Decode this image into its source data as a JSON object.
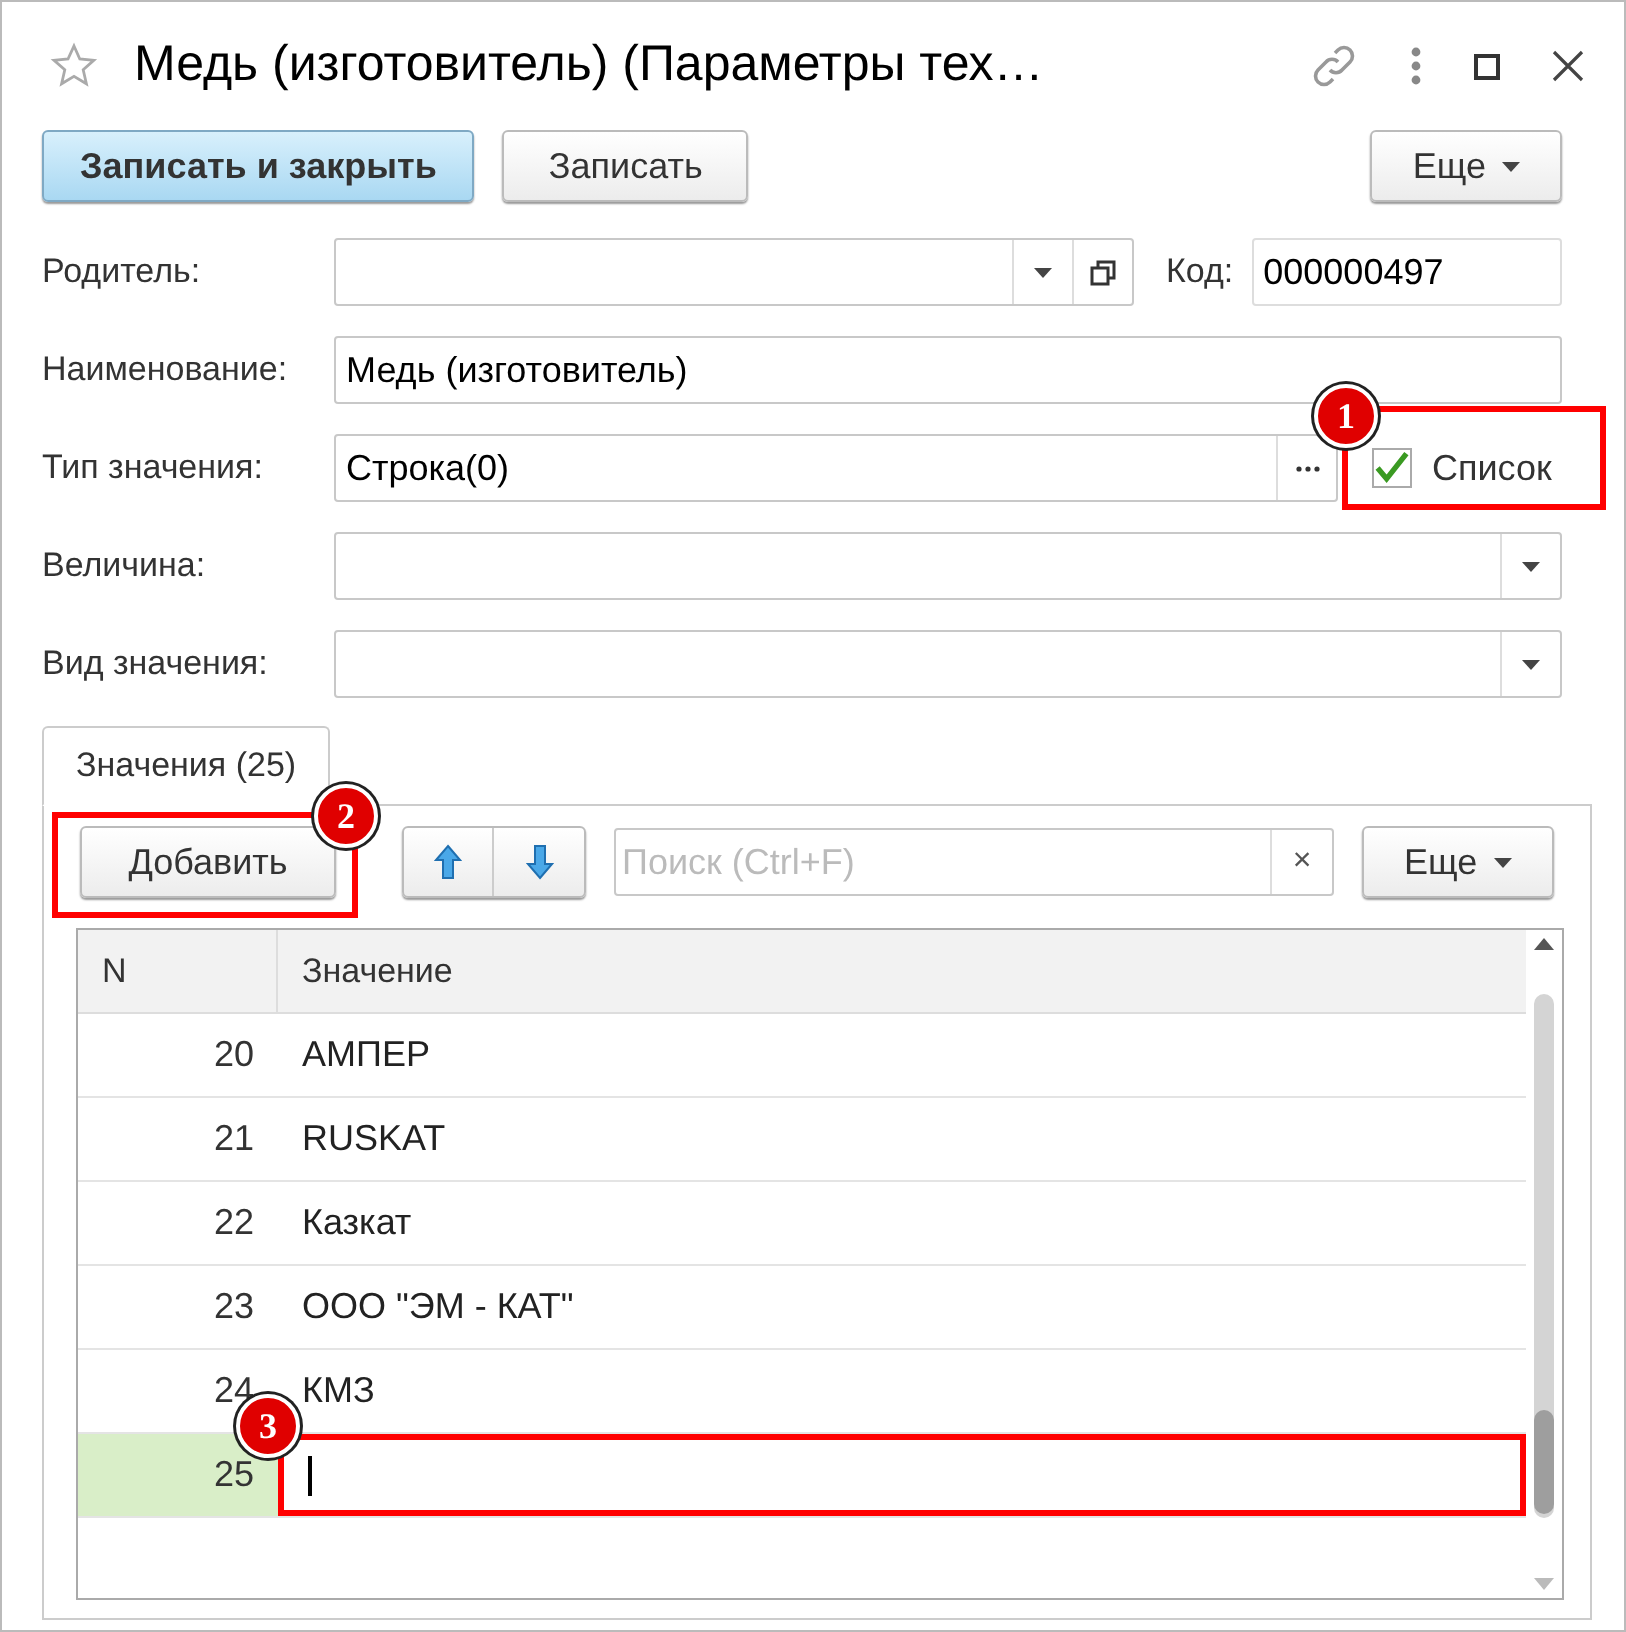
{
  "window": {
    "title": "Медь (изготовитель) (Параметры тех…"
  },
  "toolbar": {
    "buttons": [
      {
        "label": "Записать и закрыть",
        "kind": "primary"
      },
      {
        "label": "Записать",
        "kind": "normal"
      }
    ],
    "more": "Еще"
  },
  "fields": [
    {
      "label": "Родитель:",
      "kind": "parent"
    },
    {
      "label": "Наименование:",
      "kind": "text",
      "value": "Медь (изготовитель)"
    },
    {
      "label": "Тип значения:",
      "kind": "type",
      "value": "Строка(0)"
    },
    {
      "label": "Величина:",
      "kind": "select"
    },
    {
      "label": "Вид значения:",
      "kind": "select"
    }
  ],
  "code": {
    "label": "Код:",
    "value": "000000497"
  },
  "list_checkbox": {
    "label": "Список",
    "checked": true
  },
  "tabs": [
    {
      "label": "Значения (25)",
      "selected": true
    }
  ],
  "table_toolbar": {
    "add": "Добавить",
    "search": {
      "placeholder": "Поиск (Ctrl+F)"
    },
    "clear": "×",
    "more": "Еще"
  },
  "table": {
    "columns": [
      "N",
      "Значение"
    ],
    "rows": [
      {
        "n": "20",
        "value": "АМПЕР",
        "selected": false,
        "editing": false
      },
      {
        "n": "21",
        "value": "RUSKAT",
        "selected": false,
        "editing": false
      },
      {
        "n": "22",
        "value": "Казкат",
        "selected": false,
        "editing": false
      },
      {
        "n": "23",
        "value": "ООО \"ЭМ - КАТ\"",
        "selected": false,
        "editing": false
      },
      {
        "n": "24",
        "value": "КМЗ",
        "selected": false,
        "editing": false
      },
      {
        "n": "25",
        "value": "",
        "selected": true,
        "editing": true
      }
    ]
  },
  "callouts": [
    {
      "label": "1"
    },
    {
      "label": "2"
    },
    {
      "label": "3"
    }
  ]
}
